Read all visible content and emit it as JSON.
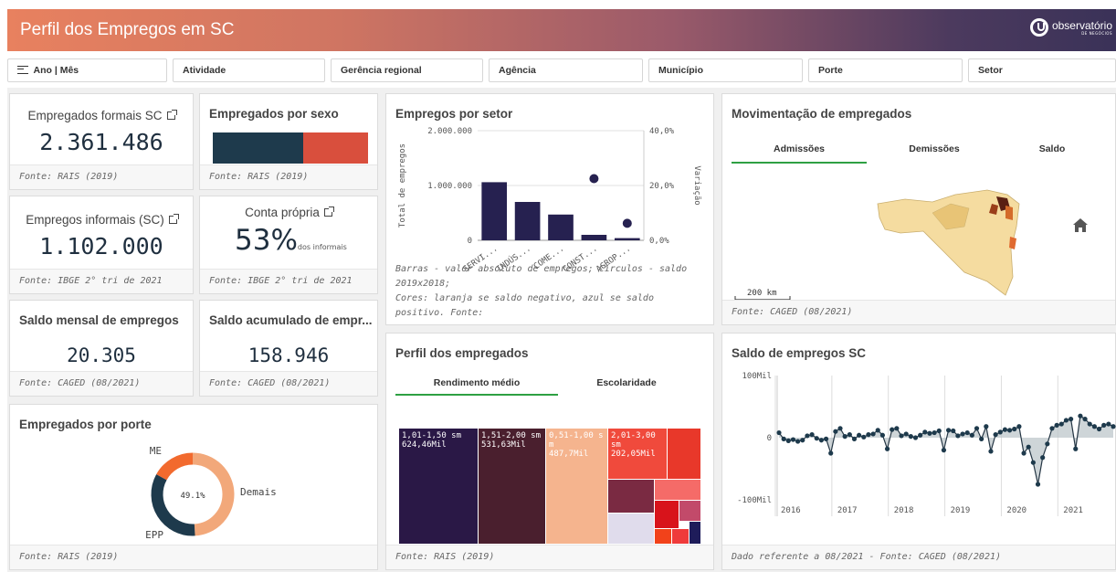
{
  "header": {
    "title": "Perfil dos Empregos em SC",
    "logo_text": "observatório",
    "logo_sub": "DE NEGÓCIOS"
  },
  "filters": [
    {
      "label": "Ano | Mês",
      "icon": "list-icon"
    },
    {
      "label": "Atividade"
    },
    {
      "label": "Gerência regional"
    },
    {
      "label": "Agência"
    },
    {
      "label": "Município"
    },
    {
      "label": "Porte"
    },
    {
      "label": "Setor"
    }
  ],
  "kpi_formais": {
    "label": "Empregados formais SC",
    "value": "2.361.486",
    "source": "Fonte: RAIS (2019)"
  },
  "sexo": {
    "title": "Empregados por sexo",
    "source": "Fonte: RAIS (2019)",
    "male_share": 0.58,
    "colors": [
      "#1e3a4c",
      "#d94f3d"
    ]
  },
  "kpi_informais": {
    "label": "Empregos informais (SC)",
    "value": "1.102.000",
    "source": "Fonte: IBGE 2° tri de 2021"
  },
  "conta_propria": {
    "label": "Conta própria",
    "value": "53%",
    "suffix": "dos informais",
    "source": "Fonte: IBGE 2° tri de 2021"
  },
  "saldo_mensal": {
    "label": "Saldo mensal de empregos",
    "value": "20.305",
    "source": "Fonte: CAGED (08/2021)"
  },
  "saldo_acum": {
    "label": "Saldo acumulado de empr...",
    "value": "158.946",
    "source": "Fonte: CAGED (08/2021)"
  },
  "porte": {
    "title": "Empregados por porte",
    "center_label": "49.1%",
    "labels": [
      "ME",
      "Demais",
      "EPP"
    ],
    "source": "Fonte: RAIS (2019)"
  },
  "setor": {
    "title": "Empregos por setor",
    "note1": "Barras - valor absoluto de empregos; Círculos - saldo 2019x2018;",
    "note2": "Cores: laranja se saldo negativo, azul se saldo positivo. Fonte:"
  },
  "movimentacao": {
    "title": "Movimentação de empregados",
    "tabs": [
      "Admissões",
      "Demissões",
      "Saldo"
    ],
    "scale_label": "200 km",
    "source": "Fonte: CAGED (08/2021)",
    "home_icon": "home-icon"
  },
  "perfil": {
    "title": "Perfil dos empregados",
    "tabs": [
      "Rendimento médio",
      "Escolaridade"
    ],
    "source": "Fonte: RAIS (2019)",
    "cells": [
      {
        "label": "1,01-1,50 sm",
        "value": "624,46Mil",
        "color": "#2a1846"
      },
      {
        "label": "1,51-2,00 sm",
        "value": "531,63Mil",
        "color": "#4a1f2e"
      },
      {
        "label": "0,51-1,00 sm",
        "value": "487,7Mil",
        "color": "#f5b48e"
      },
      {
        "label": "2,01-3,00 sm",
        "value": "202,05Mil",
        "color": "#f04a3c"
      }
    ]
  },
  "saldo_sc": {
    "title": "Saldo de empregos SC",
    "source": "Dado referente a 08/2021 - Fonte: CAGED (08/2021)"
  },
  "chart_data": [
    {
      "type": "bar",
      "title": "Empregos por setor",
      "categories": [
        "SERVI...",
        "INDÚS...",
        "COME...",
        "CONST...",
        "AGROP..."
      ],
      "series": [
        {
          "name": "Total de empregos",
          "values": [
            1060000,
            700000,
            470000,
            100000,
            40000
          ]
        },
        {
          "name": "Variação",
          "type": "scatter",
          "values": [
            null,
            null,
            null,
            0.225,
            0.062
          ]
        }
      ],
      "ylabel": "Total de empregos",
      "y2label": "Variação",
      "ylim": [
        0,
        2000000
      ],
      "y2lim": [
        0,
        0.4
      ],
      "yticks": [
        "0",
        "1.000.000",
        "2.000.000"
      ],
      "y2ticks": [
        "0,0%",
        "20,0%",
        "40,0%"
      ],
      "colors": [
        "#262150",
        "#262150"
      ]
    },
    {
      "type": "pie",
      "title": "Empregados por porte",
      "labels": [
        "ME",
        "Demais",
        "EPP"
      ],
      "values": [
        0.17,
        0.491,
        0.339
      ],
      "colors": [
        "#f26a2e",
        "#f2a87a",
        "#1e3a4c"
      ]
    },
    {
      "type": "line",
      "title": "Saldo de empregos SC",
      "x_labels": [
        "2016",
        "2017",
        "2018",
        "2019",
        "2020",
        "2021"
      ],
      "ylim": [
        -100000,
        100000
      ],
      "yticks": [
        "100Mil",
        "0",
        "-100Mil"
      ],
      "values": [
        8000,
        -2000,
        -5000,
        -3000,
        -6000,
        -4000,
        3000,
        5000,
        -1000,
        -4000,
        -2000,
        -25000,
        10000,
        15000,
        2000,
        5000,
        -2000,
        4000,
        1000,
        5000,
        6000,
        12000,
        4000,
        -18000,
        13000,
        15000,
        3000,
        6000,
        2000,
        0,
        4000,
        9000,
        7000,
        8000,
        11000,
        -20000,
        12000,
        11000,
        3000,
        6000,
        8000,
        4000,
        15000,
        -2000,
        18000,
        -22000,
        5000,
        9000,
        13000,
        12000,
        14000,
        18000,
        -25000,
        -15000,
        -40000,
        -75000,
        -32000,
        -10000,
        15000,
        20000,
        22000,
        28000,
        30000,
        -18000,
        35000,
        30000,
        22000,
        18000,
        14000,
        20000,
        22000,
        18000
      ]
    }
  ]
}
